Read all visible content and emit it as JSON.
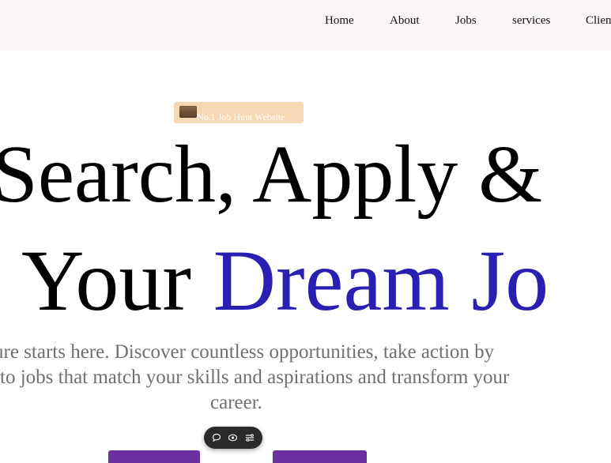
{
  "nav": {
    "items": [
      {
        "label": "Home"
      },
      {
        "label": "About"
      },
      {
        "label": "Jobs"
      },
      {
        "label": "services"
      },
      {
        "label": "Clien"
      }
    ]
  },
  "hero": {
    "badge": {
      "icon": "briefcase-icon",
      "text": "No.1 Job Hunt Website"
    },
    "headline_line1": "Search, Apply &",
    "headline_line2_plain": "Your ",
    "headline_line2_accent": "Dream Jo",
    "subtext_lines": [
      "ure starts here. Discover countless opportunities, take action by",
      "to jobs that match your skills and aspirations and transform your",
      "career."
    ],
    "accent_color": "#2a1fb0",
    "button_color": "#6a2fa1"
  },
  "floating_toolbar": {
    "icons": [
      "comment-icon",
      "eye-icon",
      "menu-icon"
    ]
  }
}
